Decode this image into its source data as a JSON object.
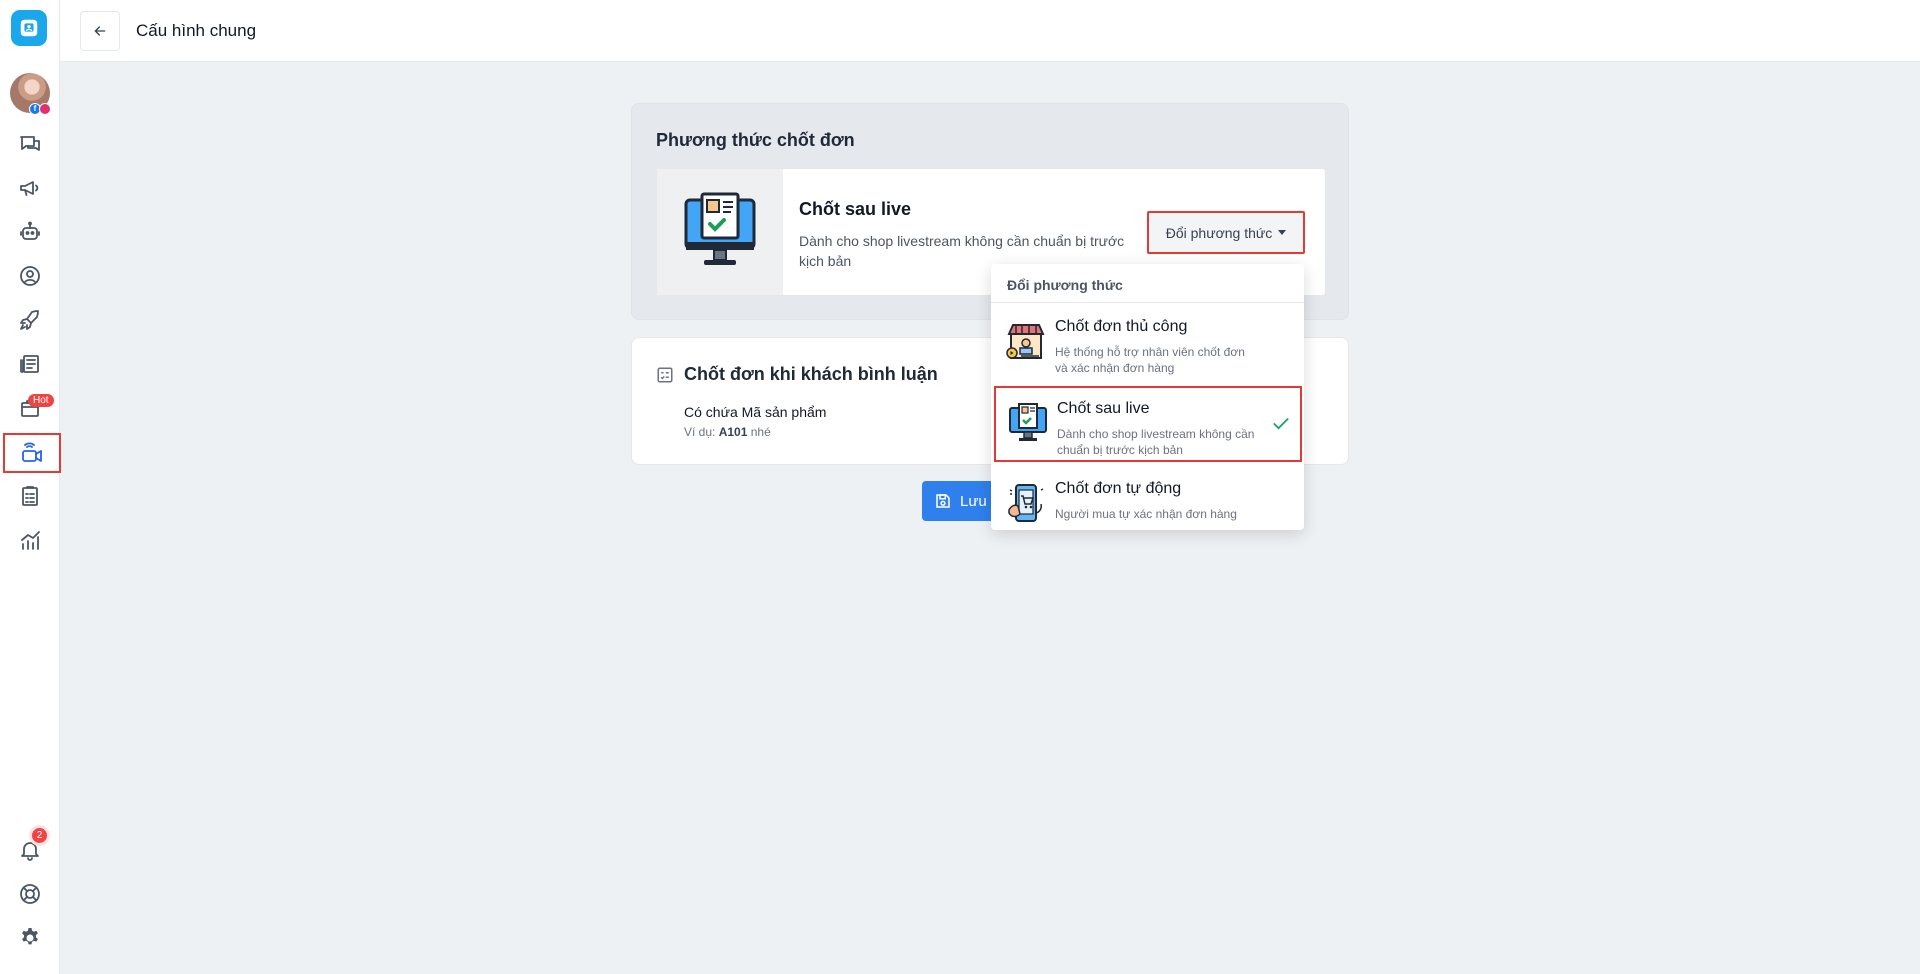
{
  "header": {
    "title": "Cấu hình chung"
  },
  "sidebar": {
    "hot_badge": "Hot",
    "notification_count": "2"
  },
  "method_card": {
    "title": "Phương thức chốt đơn",
    "current_name": "Chốt sau live",
    "current_desc": "Dành cho shop livestream không cần chuẩn bị trước kịch bản",
    "change_button": "Đổi phương thức"
  },
  "comment_card": {
    "title": "Chốt đơn khi khách bình luận",
    "rule_label": "Có chứa Mã sản phẩm",
    "example_prefix": "Ví dụ:",
    "example_code": "A101",
    "example_suffix": "nhé"
  },
  "save_button": "Lưu c",
  "dropdown": {
    "header": "Đổi phương thức",
    "items": [
      {
        "title": "Chốt đơn thủ công",
        "desc": "Hệ thống hỗ trợ nhân viên chốt đơn và xác nhận đơn hàng"
      },
      {
        "title": "Chốt sau live",
        "desc": "Dành cho shop livestream không cần chuẩn bị trước kịch bản"
      },
      {
        "title": "Chốt đơn tự động",
        "desc": "Người mua tự xác nhận đơn hàng"
      }
    ]
  },
  "colors": {
    "accent": "#2f80ed",
    "highlight": "#e53935",
    "check": "#22a06b"
  }
}
